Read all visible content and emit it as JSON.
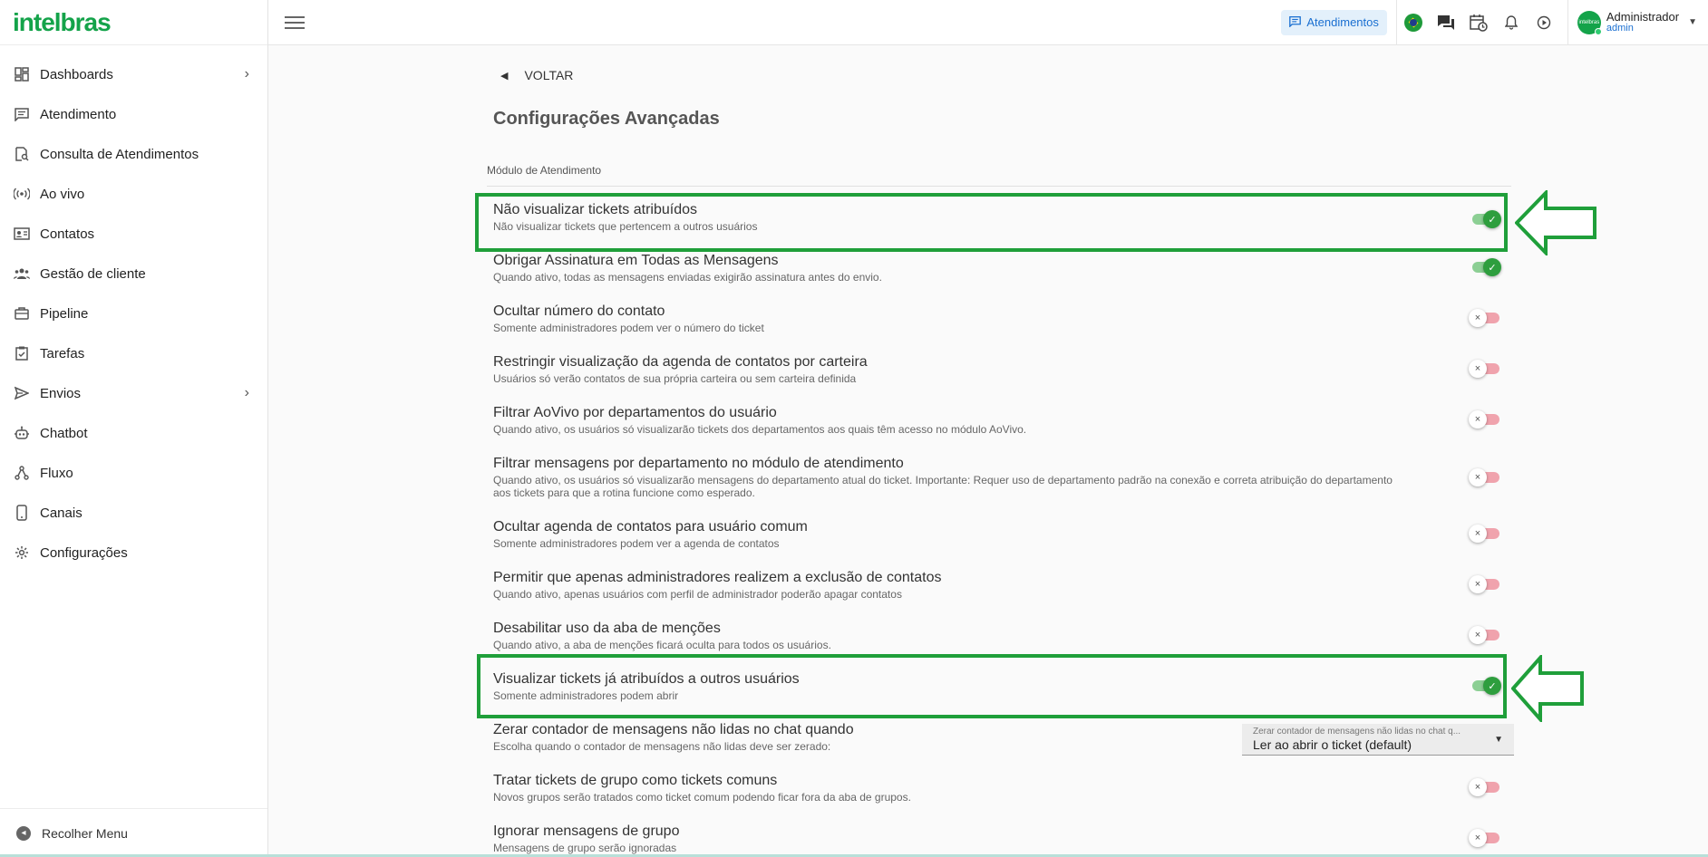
{
  "brand": {
    "logo_text": "intelbras",
    "color": "#14a34a"
  },
  "sidebar": {
    "items": [
      {
        "label": "Dashboards",
        "icon": "dashboard-icon",
        "has_chevron": true
      },
      {
        "label": "Atendimento",
        "icon": "chat-icon"
      },
      {
        "label": "Consulta de Atendimentos",
        "icon": "search-document-icon"
      },
      {
        "label": "Ao vivo",
        "icon": "live-icon"
      },
      {
        "label": "Contatos",
        "icon": "contact-card-icon"
      },
      {
        "label": "Gestão de cliente",
        "icon": "people-icon"
      },
      {
        "label": "Pipeline",
        "icon": "briefcase-icon"
      },
      {
        "label": "Tarefas",
        "icon": "task-icon"
      },
      {
        "label": "Envios",
        "icon": "send-icon",
        "has_chevron": true
      },
      {
        "label": "Chatbot",
        "icon": "robot-icon"
      },
      {
        "label": "Fluxo",
        "icon": "flow-icon"
      },
      {
        "label": "Canais",
        "icon": "phone-icon"
      },
      {
        "label": "Configurações",
        "icon": "gear-icon"
      }
    ],
    "collapse_label": "Recolher Menu"
  },
  "topbar": {
    "atendimentos_label": "Atendimentos",
    "user": {
      "name": "Administrador",
      "role": "admin",
      "avatar_text": "intelbras"
    }
  },
  "main": {
    "back_label": "VOLTAR",
    "title": "Configurações Avançadas",
    "section_label": "Módulo de Atendimento",
    "settings": [
      {
        "title": "Não visualizar tickets atribuídos",
        "desc": "Não visualizar tickets que pertencem a outros usuários",
        "state": "on"
      },
      {
        "title": "Obrigar Assinatura em Todas as Mensagens",
        "desc": "Quando ativo, todas as mensagens enviadas exigirão assinatura antes do envio.",
        "state": "on"
      },
      {
        "title": "Ocultar número do contato",
        "desc": "Somente administradores podem ver o número do ticket",
        "state": "off"
      },
      {
        "title": "Restringir visualização da agenda de contatos por carteira",
        "desc": "Usuários só verão contatos de sua própria carteira ou sem carteira definida",
        "state": "off"
      },
      {
        "title": "Filtrar AoVivo por departamentos do usuário",
        "desc": "Quando ativo, os usuários só visualizarão tickets dos departamentos aos quais têm acesso no módulo AoVivo.",
        "state": "off"
      },
      {
        "title": "Filtrar mensagens por departamento no módulo de atendimento",
        "desc": "Quando ativo, os usuários só visualizarão mensagens do departamento atual do ticket. Importante: Requer uso de departamento padrão na conexão e correta atribuição do departamento aos tickets para que a rotina funcione como esperado.",
        "state": "off"
      },
      {
        "title": "Ocultar agenda de contatos para usuário comum",
        "desc": "Somente administradores podem ver a agenda de contatos",
        "state": "off"
      },
      {
        "title": "Permitir que apenas administradores realizem a exclusão de contatos",
        "desc": "Quando ativo, apenas usuários com perfil de administrador poderão apagar contatos",
        "state": "off"
      },
      {
        "title": "Desabilitar uso da aba de menções",
        "desc": "Quando ativo, a aba de menções ficará oculta para todos os usuários.",
        "state": "off"
      },
      {
        "title": "Visualizar tickets já atribuídos a outros usuários",
        "desc": "Somente administradores podem abrir",
        "state": "on"
      },
      {
        "title": "Zerar contador de mensagens não lidas no chat quando",
        "desc": "Escolha quando o contador de mensagens não lidas deve ser zerado:",
        "state": "select",
        "select_label": "Zerar contador de mensagens não lidas no chat q...",
        "select_value": "Ler ao abrir o ticket (default)"
      },
      {
        "title": "Tratar tickets de grupo como tickets comuns",
        "desc": "Novos grupos serão tratados como ticket comum podendo ficar fora da aba de grupos.",
        "state": "off"
      },
      {
        "title": "Ignorar mensagens de grupo",
        "desc": "Mensagens de grupo serão ignoradas",
        "state": "off"
      }
    ]
  },
  "colors": {
    "highlight": "#1f9f3a",
    "toggle_on": "#2e9e3e",
    "toggle_off_track": "#f0a3ad",
    "link_blue": "#1a6fd1"
  }
}
